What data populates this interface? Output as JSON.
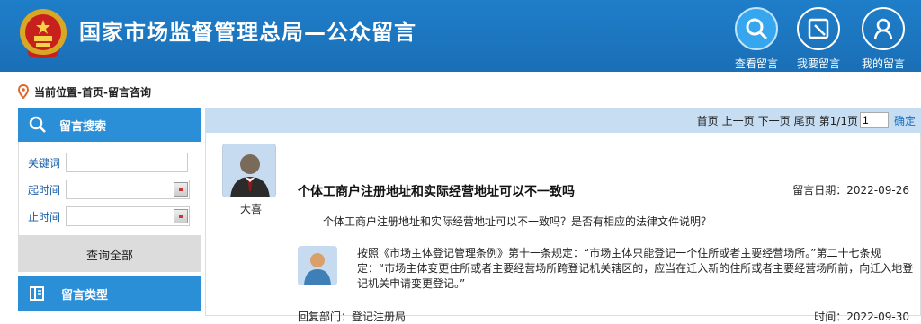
{
  "header": {
    "site_title": "国家市场监督管理总局—公众留言",
    "nav": [
      {
        "label": "查看留言",
        "icon": "search-icon"
      },
      {
        "label": "我要留言",
        "icon": "edit-icon"
      },
      {
        "label": "我的留言",
        "icon": "user-icon"
      }
    ]
  },
  "breadcrumb": {
    "text": "当前位置-首页-留言咨询"
  },
  "sidebar": {
    "search_title": "留言搜索",
    "keyword_label": "关键词",
    "keyword_value": "",
    "start_label": "起时间",
    "start_value": "",
    "end_label": "止时间",
    "end_value": "",
    "query_all": "查询全部",
    "type_title": "留言类型"
  },
  "pager": {
    "first": "首页",
    "prev": "上一页",
    "next": "下一页",
    "last": "尾页",
    "page_info": "第1/1页",
    "page_value": "1",
    "confirm": "确定"
  },
  "message": {
    "asker": "大喜",
    "title": "个体工商户注册地址和实际经营地址可以不一致吗",
    "date_label": "留言日期：2022-09-26",
    "body": "个体工商户注册地址和实际经营地址可以不一致吗？是否有相应的法律文件说明？",
    "reply": "按照《市场主体登记管理条例》第十一条规定：“市场主体只能登记一个住所或者主要经营场所。”第二十七条规定：“市场主体变更住所或者主要经营场所跨登记机关辖区的，应当在迁入新的住所或者主要经营场所前，向迁入地登记机关申请变更登记。”",
    "reply_dept": "回复部门：登记注册局",
    "reply_time": "时间：2022-09-30"
  },
  "colors": {
    "header_blue": "#1f7ec9",
    "sidebar_blue": "#2b8fd8",
    "pager_bg": "#c7ddf2"
  }
}
